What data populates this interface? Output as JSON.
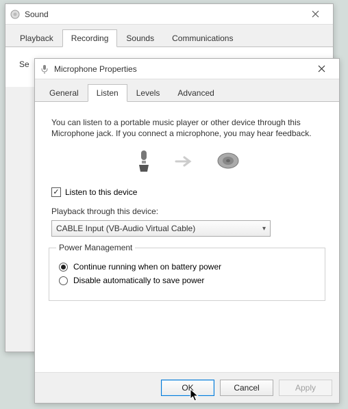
{
  "sound": {
    "title": "Sound",
    "tabs": [
      "Playback",
      "Recording",
      "Sounds",
      "Communications"
    ],
    "active_tab_index": 1,
    "body_text": "Se"
  },
  "mic": {
    "title": "Microphone Properties",
    "tabs": [
      "General",
      "Listen",
      "Levels",
      "Advanced"
    ],
    "active_tab_index": 1,
    "description": "You can listen to a portable music player or other device through this Microphone jack.  If you connect a microphone, you may hear feedback.",
    "listen_checkbox_label": "Listen to this device",
    "listen_checked": true,
    "playback_label": "Playback through this device:",
    "playback_selected": "CABLE Input (VB-Audio Virtual Cable)",
    "power_legend": "Power Management",
    "power_options": [
      "Continue running when on battery power",
      "Disable automatically to save power"
    ],
    "power_selected_index": 0,
    "buttons": {
      "ok": "OK",
      "cancel": "Cancel",
      "apply": "Apply"
    }
  }
}
